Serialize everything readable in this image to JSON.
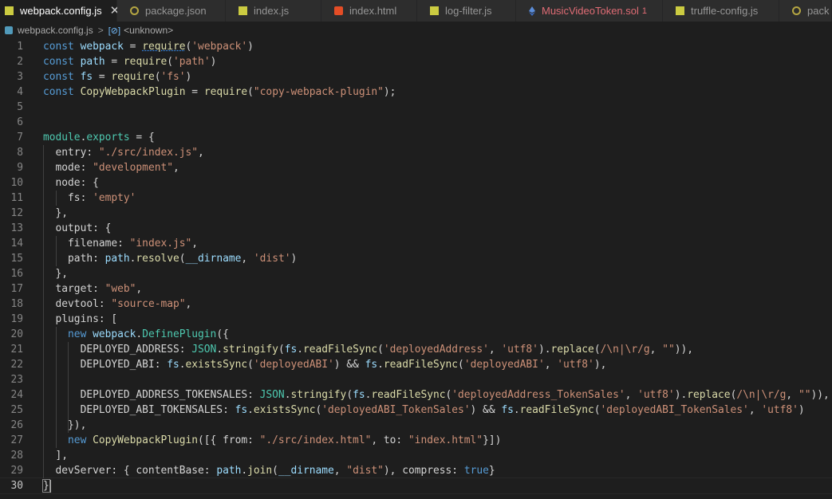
{
  "tabs": [
    {
      "label": "webpack.config.js",
      "icon": "js-file-icon",
      "active": true,
      "close": "✕"
    },
    {
      "label": "package.json",
      "icon": "npm-gear-icon",
      "active": false
    },
    {
      "label": "index.js",
      "icon": "js-file-icon",
      "active": false
    },
    {
      "label": "index.html",
      "icon": "html5-icon",
      "active": false
    },
    {
      "label": "log-filter.js",
      "icon": "js-file-icon",
      "active": false
    },
    {
      "label": "MusicVideoToken.sol",
      "icon": "ethereum-diamond-icon",
      "active": false,
      "badge": "1"
    },
    {
      "label": "truffle-config.js",
      "icon": "js-file-icon",
      "active": false
    },
    {
      "label": "pack",
      "icon": "npm-gear-icon",
      "active": false
    }
  ],
  "breadcrumb": {
    "file": "webpack.config.js",
    "separator": ">",
    "symbol_icon": "[⊘]",
    "symbol": "<unknown>"
  },
  "colors": {
    "keyword": "#569cd6",
    "variable": "#9cdcfe",
    "string": "#ce9178",
    "function": "#dcdcaa",
    "class": "#4ec9b0",
    "background": "#1e1e1e"
  },
  "code": {
    "lines": [
      {
        "n": "1",
        "tokens": [
          [
            "kw",
            "const "
          ],
          [
            "var",
            "webpack"
          ],
          [
            "p",
            " = "
          ],
          [
            "fnsq",
            "require"
          ],
          [
            "p",
            "("
          ],
          [
            "str",
            "'webpack'"
          ],
          [
            "p",
            ")"
          ]
        ]
      },
      {
        "n": "2",
        "tokens": [
          [
            "kw",
            "const "
          ],
          [
            "var",
            "path"
          ],
          [
            "p",
            " = "
          ],
          [
            "fn",
            "require"
          ],
          [
            "p",
            "("
          ],
          [
            "str",
            "'path'"
          ],
          [
            "p",
            ")"
          ]
        ]
      },
      {
        "n": "3",
        "tokens": [
          [
            "kw",
            "const "
          ],
          [
            "var",
            "fs"
          ],
          [
            "p",
            " = "
          ],
          [
            "fn",
            "require"
          ],
          [
            "p",
            "("
          ],
          [
            "str",
            "'fs'"
          ],
          [
            "p",
            ")"
          ]
        ]
      },
      {
        "n": "4",
        "tokens": [
          [
            "kw",
            "const "
          ],
          [
            "fn",
            "CopyWebpackPlugin"
          ],
          [
            "p",
            " = "
          ],
          [
            "fn",
            "require"
          ],
          [
            "p",
            "("
          ],
          [
            "str",
            "\"copy-webpack-plugin\""
          ],
          [
            "p",
            ");"
          ]
        ]
      },
      {
        "n": "5",
        "tokens": []
      },
      {
        "n": "6",
        "tokens": []
      },
      {
        "n": "7",
        "tokens": [
          [
            "cls",
            "module"
          ],
          [
            "p",
            "."
          ],
          [
            "cls",
            "exports"
          ],
          [
            "p",
            " = {"
          ]
        ]
      },
      {
        "n": "8",
        "tokens": [
          [
            "p",
            "  entry: "
          ],
          [
            "str",
            "\"./src/index.js\""
          ],
          [
            "p",
            ","
          ]
        ]
      },
      {
        "n": "9",
        "tokens": [
          [
            "p",
            "  mode: "
          ],
          [
            "str",
            "\"development\""
          ],
          [
            "p",
            ","
          ]
        ]
      },
      {
        "n": "10",
        "tokens": [
          [
            "p",
            "  node: {"
          ]
        ]
      },
      {
        "n": "11",
        "tokens": [
          [
            "p",
            "    fs: "
          ],
          [
            "str",
            "'empty'"
          ]
        ]
      },
      {
        "n": "12",
        "tokens": [
          [
            "p",
            "  },"
          ]
        ]
      },
      {
        "n": "13",
        "tokens": [
          [
            "p",
            "  output: {"
          ]
        ]
      },
      {
        "n": "14",
        "tokens": [
          [
            "p",
            "    filename: "
          ],
          [
            "str",
            "\"index.js\""
          ],
          [
            "p",
            ","
          ]
        ]
      },
      {
        "n": "15",
        "tokens": [
          [
            "p",
            "    path: "
          ],
          [
            "var",
            "path"
          ],
          [
            "p",
            "."
          ],
          [
            "fn",
            "resolve"
          ],
          [
            "p",
            "("
          ],
          [
            "var",
            "__dirname"
          ],
          [
            "p",
            ", "
          ],
          [
            "str",
            "'dist'"
          ],
          [
            "p",
            ")"
          ]
        ]
      },
      {
        "n": "16",
        "tokens": [
          [
            "p",
            "  },"
          ]
        ]
      },
      {
        "n": "17",
        "tokens": [
          [
            "p",
            "  target: "
          ],
          [
            "str",
            "\"web\""
          ],
          [
            "p",
            ","
          ]
        ]
      },
      {
        "n": "18",
        "tokens": [
          [
            "p",
            "  devtool: "
          ],
          [
            "str",
            "\"source-map\""
          ],
          [
            "p",
            ","
          ]
        ]
      },
      {
        "n": "19",
        "tokens": [
          [
            "p",
            "  plugins: ["
          ]
        ]
      },
      {
        "n": "20",
        "tokens": [
          [
            "p",
            "    "
          ],
          [
            "kw",
            "new "
          ],
          [
            "var",
            "webpack"
          ],
          [
            "p",
            "."
          ],
          [
            "cls",
            "DefinePlugin"
          ],
          [
            "p",
            "({"
          ]
        ]
      },
      {
        "n": "21",
        "tokens": [
          [
            "p",
            "      DEPLOYED_ADDRESS: "
          ],
          [
            "cls",
            "JSON"
          ],
          [
            "p",
            "."
          ],
          [
            "fn",
            "stringify"
          ],
          [
            "p",
            "("
          ],
          [
            "var",
            "fs"
          ],
          [
            "p",
            "."
          ],
          [
            "fn",
            "readFileSync"
          ],
          [
            "p",
            "("
          ],
          [
            "str",
            "'deployedAddress'"
          ],
          [
            "p",
            ", "
          ],
          [
            "str",
            "'utf8'"
          ],
          [
            "p",
            ")."
          ],
          [
            "fn",
            "replace"
          ],
          [
            "p",
            "("
          ],
          [
            "str",
            "/\\n|\\r/g"
          ],
          [
            "p",
            ", "
          ],
          [
            "str",
            "\"\""
          ],
          [
            "p",
            "))"
          ],
          [
            "p",
            ","
          ]
        ]
      },
      {
        "n": "22",
        "tokens": [
          [
            "p",
            "      DEPLOYED_ABI: "
          ],
          [
            "var",
            "fs"
          ],
          [
            "p",
            "."
          ],
          [
            "fn",
            "existsSync"
          ],
          [
            "p",
            "("
          ],
          [
            "str",
            "'deployedABI'"
          ],
          [
            "p",
            ") && "
          ],
          [
            "var",
            "fs"
          ],
          [
            "p",
            "."
          ],
          [
            "fn",
            "readFileSync"
          ],
          [
            "p",
            "("
          ],
          [
            "str",
            "'deployedABI'"
          ],
          [
            "p",
            ", "
          ],
          [
            "str",
            "'utf8'"
          ],
          [
            "p",
            "),"
          ]
        ]
      },
      {
        "n": "23",
        "tokens": []
      },
      {
        "n": "24",
        "tokens": [
          [
            "p",
            "      DEPLOYED_ADDRESS_TOKENSALES: "
          ],
          [
            "cls",
            "JSON"
          ],
          [
            "p",
            "."
          ],
          [
            "fn",
            "stringify"
          ],
          [
            "p",
            "("
          ],
          [
            "var",
            "fs"
          ],
          [
            "p",
            "."
          ],
          [
            "fn",
            "readFileSync"
          ],
          [
            "p",
            "("
          ],
          [
            "str",
            "'deployedAddress_TokenSales'"
          ],
          [
            "p",
            ", "
          ],
          [
            "str",
            "'utf8'"
          ],
          [
            "p",
            ")."
          ],
          [
            "fn",
            "replace"
          ],
          [
            "p",
            "("
          ],
          [
            "str",
            "/\\n|\\r/g"
          ],
          [
            "p",
            ", "
          ],
          [
            "str",
            "\"\""
          ],
          [
            "p",
            "))"
          ],
          [
            "p",
            ","
          ]
        ]
      },
      {
        "n": "25",
        "tokens": [
          [
            "p",
            "      DEPLOYED_ABI_TOKENSALES: "
          ],
          [
            "var",
            "fs"
          ],
          [
            "p",
            "."
          ],
          [
            "fn",
            "existsSync"
          ],
          [
            "p",
            "("
          ],
          [
            "str",
            "'deployedABI_TokenSales'"
          ],
          [
            "p",
            ") && "
          ],
          [
            "var",
            "fs"
          ],
          [
            "p",
            "."
          ],
          [
            "fn",
            "readFileSync"
          ],
          [
            "p",
            "("
          ],
          [
            "str",
            "'deployedABI_TokenSales'"
          ],
          [
            "p",
            ", "
          ],
          [
            "str",
            "'utf8'"
          ],
          [
            "p",
            ")"
          ]
        ]
      },
      {
        "n": "26",
        "tokens": [
          [
            "p",
            "    }),"
          ]
        ]
      },
      {
        "n": "27",
        "tokens": [
          [
            "p",
            "    "
          ],
          [
            "kw",
            "new "
          ],
          [
            "fn",
            "CopyWebpackPlugin"
          ],
          [
            "p",
            "([{ from: "
          ],
          [
            "str",
            "\"./src/index.html\""
          ],
          [
            "p",
            ", to: "
          ],
          [
            "str",
            "\"index.html\""
          ],
          [
            "p",
            "}])"
          ]
        ]
      },
      {
        "n": "28",
        "tokens": [
          [
            "p",
            "  ],"
          ]
        ]
      },
      {
        "n": "29",
        "tokens": [
          [
            "p",
            "  devServer: { contentBase: "
          ],
          [
            "var",
            "path"
          ],
          [
            "p",
            "."
          ],
          [
            "fn",
            "join"
          ],
          [
            "p",
            "("
          ],
          [
            "var",
            "__dirname"
          ],
          [
            "p",
            ", "
          ],
          [
            "str",
            "\"dist\""
          ],
          [
            "p",
            "), compress: "
          ],
          [
            "kw",
            "true"
          ],
          [
            "p",
            "}"
          ]
        ]
      },
      {
        "n": "30",
        "tokens": [
          [
            "pmatch",
            "}"
          ]
        ],
        "current": true
      }
    ]
  }
}
